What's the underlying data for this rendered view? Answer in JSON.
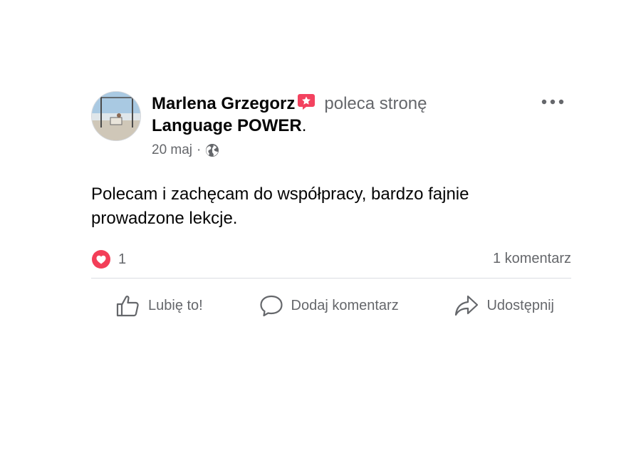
{
  "post": {
    "author": "Marlena Grzegorz",
    "action": "poleca stronę",
    "page": "Language POWER",
    "page_suffix": ".",
    "date": "20 maj",
    "separator": "·",
    "text": "Polecam i zachęcam do współpracy, bardzo fajnie prowadzone lekcje.",
    "reaction_count": "1",
    "comments": "1 komentarz"
  },
  "actions": {
    "like": "Lubię to!",
    "comment": "Dodaj komentarz",
    "share": "Udostępnij"
  },
  "icons": {
    "recommend_badge": "recommend-star-badge-icon",
    "audience": "globe-icon",
    "more": "more-options-icon",
    "reaction": "love-heart-icon",
    "like": "thumbs-up-icon",
    "comment": "speech-bubble-icon",
    "share": "share-arrow-icon"
  },
  "colors": {
    "badge": "#f3425f",
    "heart": "#f33e58",
    "secondary_text": "#65676b",
    "primary_text": "#050505",
    "divider": "#dadde1"
  }
}
